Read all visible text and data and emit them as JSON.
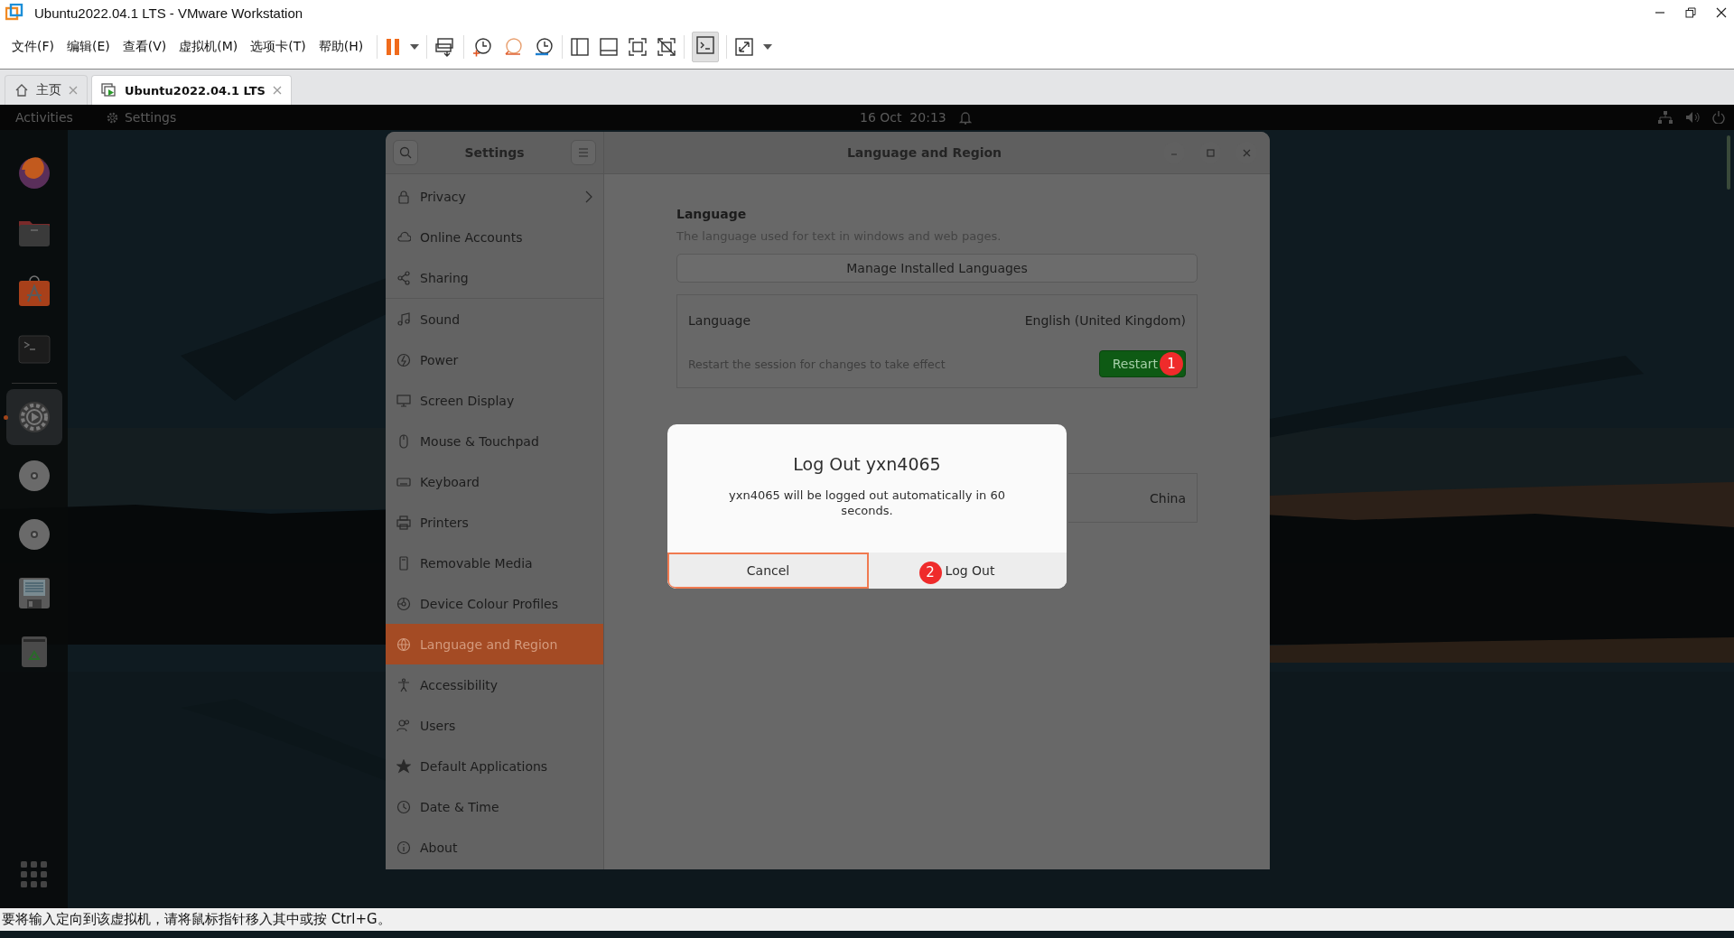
{
  "window": {
    "title": "Ubuntu2022.04.1 LTS - VMware Workstation"
  },
  "menu": [
    "文件(F)",
    "编辑(E)",
    "查看(V)",
    "虚拟机(M)",
    "选项卡(T)",
    "帮助(H)"
  ],
  "tabs": [
    {
      "label": "主页",
      "selected": false
    },
    {
      "label": "Ubuntu2022.04.1 LTS",
      "selected": true
    }
  ],
  "top_bar": {
    "activities": "Activities",
    "app": "Settings",
    "clock": "16 Oct  20:13"
  },
  "dock": {
    "items": [
      {
        "running": false
      },
      {
        "running": false
      },
      {
        "running": false
      },
      {
        "running": false
      },
      {
        "running": true
      },
      {
        "running": false
      },
      {
        "running": false
      },
      {
        "running": false
      },
      {
        "running": false
      }
    ]
  },
  "settings": {
    "title": "Settings",
    "page_title": "Language and Region",
    "sidebar": {
      "items": [
        {
          "label": "Privacy",
          "selected": false,
          "submenu": true
        },
        {
          "label": "Online Accounts",
          "selected": false,
          "submenu": false
        },
        {
          "label": "Sharing",
          "selected": false,
          "submenu": false
        },
        {
          "label": "Sound",
          "selected": false,
          "submenu": false
        },
        {
          "label": "Power",
          "selected": false,
          "submenu": false
        },
        {
          "label": "Screen Display",
          "selected": false,
          "submenu": false
        },
        {
          "label": "Mouse & Touchpad",
          "selected": false,
          "submenu": false
        },
        {
          "label": "Keyboard",
          "selected": false,
          "submenu": false
        },
        {
          "label": "Printers",
          "selected": false,
          "submenu": false
        },
        {
          "label": "Removable Media",
          "selected": false,
          "submenu": false
        },
        {
          "label": "Device Colour Profiles",
          "selected": false,
          "submenu": false
        },
        {
          "label": "Language and Region",
          "selected": true,
          "submenu": false
        },
        {
          "label": "Accessibility",
          "selected": false,
          "submenu": false
        },
        {
          "label": "Users",
          "selected": false,
          "submenu": false
        },
        {
          "label": "Default Applications",
          "selected": false,
          "submenu": false
        },
        {
          "label": "Date & Time",
          "selected": false,
          "submenu": false
        },
        {
          "label": "About",
          "selected": false,
          "submenu": false
        }
      ]
    },
    "language_section": {
      "heading": "Language",
      "description": "The language used for text in windows and web pages.",
      "manage_button": "Manage Installed Languages",
      "row_label": "Language",
      "row_value": "English (United Kingdom)",
      "notice": "Restart the session for changes to take effect",
      "restart_button": "Restart",
      "restart_badge": "1"
    },
    "formats_section": {
      "row_value": "China"
    }
  },
  "dialog": {
    "title": "Log Out yxn4065",
    "message": "yxn4065 will be logged out automatically in 60 seconds.",
    "buttons": [
      {
        "label": "Cancel",
        "focused": true
      },
      {
        "label": "Log Out",
        "focused": false,
        "badge": "2"
      }
    ]
  },
  "status_bar": {
    "text": "要将输入定向到该虚拟机，请将鼠标指针移入其中或按 Ctrl+G。"
  }
}
